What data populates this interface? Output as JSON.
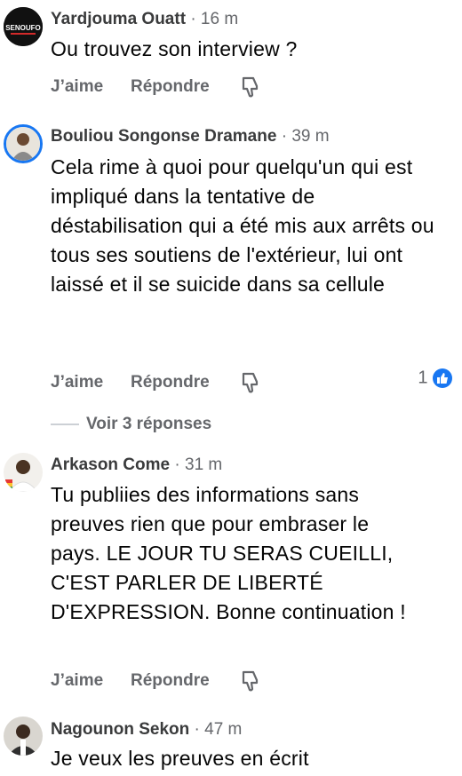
{
  "comments": [
    {
      "author": "Yardjouma Ouatt",
      "time": "16 m",
      "text": "Ou trouvez son  interview ?",
      "avatar_text": "SENOUFO",
      "like_label": "J’aime",
      "reply_label": "Répondre"
    },
    {
      "author": "Bouliou Songonse Dramane",
      "time": "39 m",
      "text": "Cela rime à quoi pour quelqu'un qui est impliqué dans la tentative de déstabilisation qui a été mis aux arrêts ou tous ses soutiens de l'extérieur, lui ont laissé et il se suicide dans sa cellule",
      "like_label": "J’aime",
      "reply_label": "Répondre",
      "reaction_count": "1",
      "view_replies_label": "Voir 3 réponses"
    },
    {
      "author": "Arkason Come",
      "time": "31 m",
      "text": "Tu publiies des informations sans preuves rien que pour embraser le pays. LE JOUR TU SERAS CUEILLI, C'EST PARLER DE LIBERTÉ D'EXPRESSION. Bonne continuation !",
      "like_label": "J’aime",
      "reply_label": "Répondre"
    },
    {
      "author": "Nagounon Sekon",
      "time": "47 m",
      "text": "Je veux les preuves en écrit"
    }
  ],
  "separator": "·",
  "icons": {
    "dislike": "thumbs-down-icon",
    "reaction": "like-reaction-icon"
  },
  "colors": {
    "reaction_blue": "#1877f2",
    "secondary_text": "#65676b"
  }
}
